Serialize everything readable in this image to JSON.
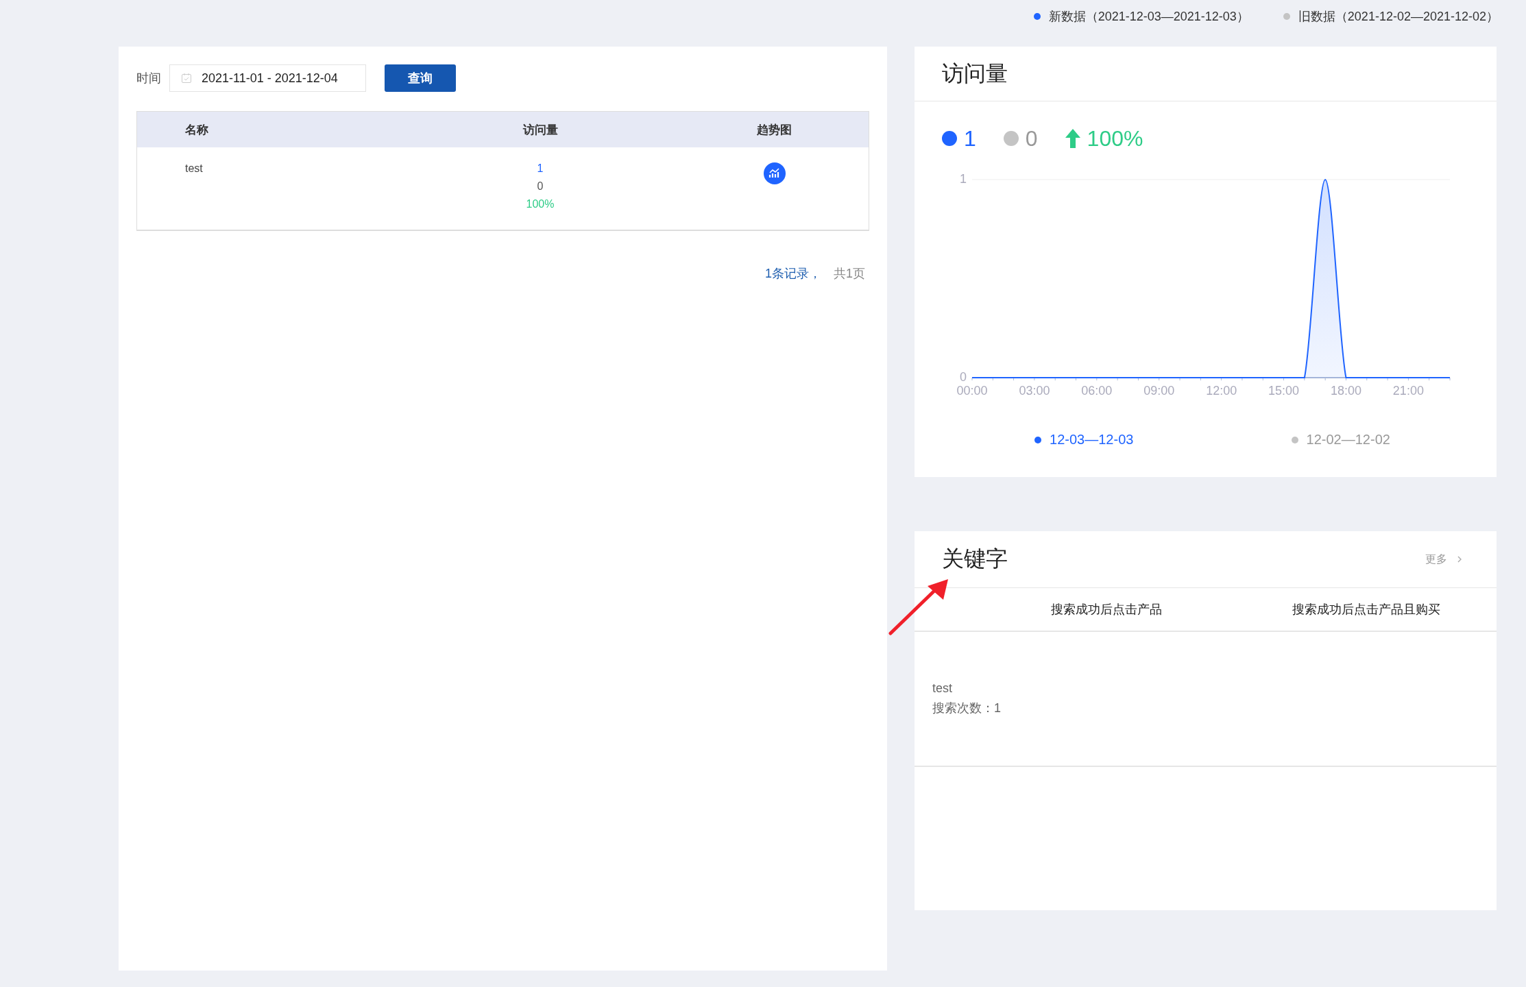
{
  "legend": [
    {
      "label": "新数据（2021-12-03—2021-12-03）",
      "color": "#1f64ff"
    },
    {
      "label": "旧数据（2021-12-02—2021-12-02）",
      "color": "#c4c4c4"
    }
  ],
  "filter": {
    "label": "时间",
    "date_range": "2021-11-01 - 2021-12-04",
    "button": "查询"
  },
  "table": {
    "columns": [
      "名称",
      "访问量",
      "趋势图"
    ],
    "rows": [
      {
        "name": "test",
        "new": "1",
        "old": "0",
        "change": "100%"
      }
    ]
  },
  "pagination": {
    "records": "1条记录，",
    "pages": "共1页"
  },
  "visits": {
    "title": "访问量",
    "stats": [
      {
        "kind": "value",
        "text": "1",
        "color": "#1f64ff"
      },
      {
        "kind": "value",
        "text": "0",
        "color": "#c4c4c4"
      },
      {
        "kind": "change",
        "text": "100%",
        "color": "#2ecc87"
      }
    ],
    "chart_data": {
      "type": "area",
      "x": [
        0,
        1,
        2,
        3,
        4,
        5,
        6,
        7,
        8,
        9,
        10,
        11,
        12,
        13,
        14,
        15,
        16,
        17,
        18,
        19,
        20,
        21,
        22,
        23
      ],
      "xlim": [
        0,
        23
      ],
      "ylim": [
        0,
        1
      ],
      "yticks": [
        0,
        1
      ],
      "xticks": [
        {
          "value": 0,
          "label": "00:00"
        },
        {
          "value": 3,
          "label": "03:00"
        },
        {
          "value": 6,
          "label": "06:00"
        },
        {
          "value": 9,
          "label": "09:00"
        },
        {
          "value": 12,
          "label": "12:00"
        },
        {
          "value": 15,
          "label": "15:00"
        },
        {
          "value": 18,
          "label": "18:00"
        },
        {
          "value": 21,
          "label": "21:00"
        }
      ],
      "series": [
        {
          "color": "#1f64ff",
          "values": [
            0,
            0,
            0,
            0,
            0,
            0,
            0,
            0,
            0,
            0,
            0,
            0,
            0,
            0,
            0,
            0,
            0,
            1,
            0,
            0,
            0,
            0,
            0,
            0
          ]
        }
      ]
    },
    "chart_legend": [
      {
        "label": "12-03—12-03",
        "color": "#1f64ff"
      },
      {
        "label": "12-02—12-02",
        "color": "#c4c4c4"
      }
    ]
  },
  "keywords": {
    "title": "关键字",
    "more": "更多",
    "columns": [
      "搜索成功后点击产品",
      "搜索成功后点击产品且购买"
    ],
    "rows": [
      {
        "keyword": "test",
        "count": "搜索次数：1"
      }
    ]
  }
}
